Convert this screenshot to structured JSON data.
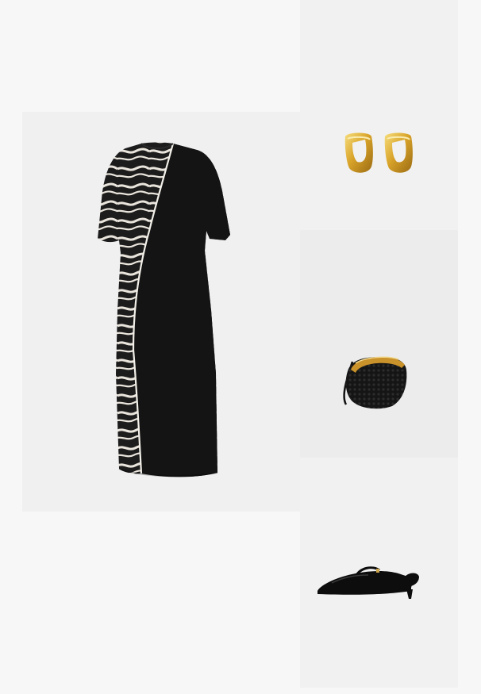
{
  "outfit": {
    "items": [
      {
        "name": "dress",
        "colors": {
          "primary": "#141414",
          "print": "#e9e4dc",
          "piping": "#f2efe8"
        }
      },
      {
        "name": "earrings",
        "colors": {
          "metal": "#d9a42a",
          "highlight": "#f6dd7c",
          "shadow": "#9a6a12"
        }
      },
      {
        "name": "bag",
        "colors": {
          "body": "#121212",
          "handle": "#c9922a"
        }
      },
      {
        "name": "shoes",
        "colors": {
          "leather": "#0d0d0d",
          "buckle": "#c9a34a"
        }
      }
    ]
  }
}
